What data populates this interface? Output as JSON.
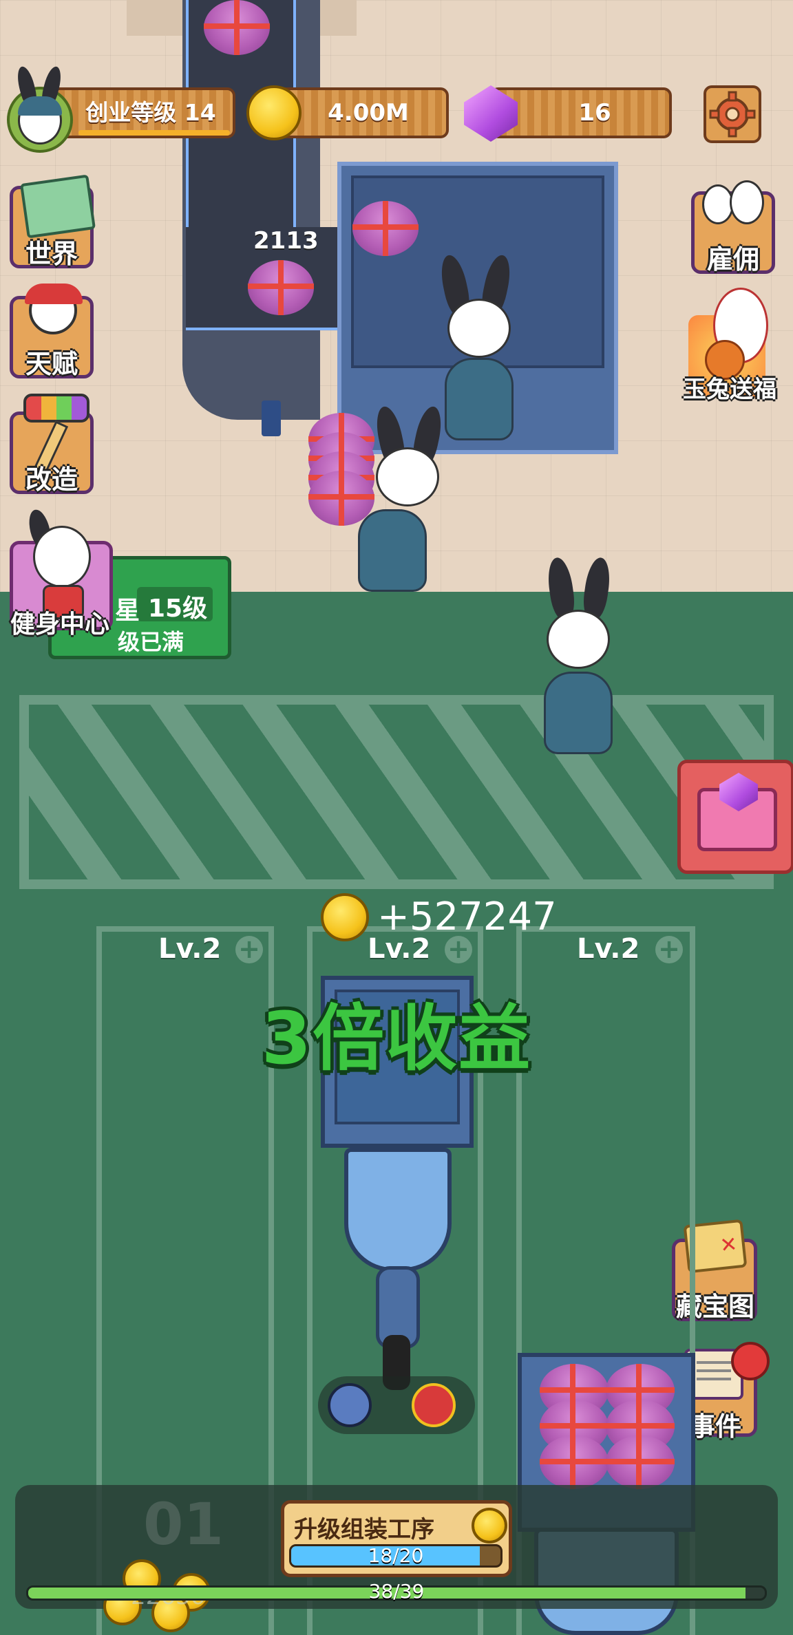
{
  "hud": {
    "level_label": "创业等级 14",
    "coins": "4.00M",
    "gems": "16",
    "settings_icon": "gear-icon"
  },
  "left_menu": [
    {
      "label": "世界",
      "icon": "world-map-icon"
    },
    {
      "label": "天赋",
      "icon": "talent-icon"
    },
    {
      "label": "改造",
      "icon": "paint-roller-icon"
    },
    {
      "label": "健身中心",
      "icon": "gym-icon"
    }
  ],
  "right_menu": [
    {
      "label": "雇佣",
      "icon": "hire-rabbits-icon"
    },
    {
      "label": "玉兔送福",
      "icon": "jade-rabbit-icon"
    },
    {
      "label": "藏宝图",
      "icon": "treasure-map-icon"
    },
    {
      "label": "事件",
      "icon": "events-icon"
    }
  ],
  "gym_sign": {
    "level": "15级",
    "status_fragment": "级已满",
    "cut_fragment": "星"
  },
  "conveyor_counter": "2113",
  "income_popup": "+527247",
  "multiplier_banner": "3倍收益",
  "lanes": [
    {
      "label": "Lv.2"
    },
    {
      "label": "Lv.2"
    },
    {
      "label": "Lv.2"
    }
  ],
  "bottom": {
    "station_number": "01",
    "upgrade_title": "升级组装工序",
    "upgrade_progress_text": "18/20",
    "upgrade_progress": 0.9,
    "main_progress_text": "38/39",
    "main_progress": 0.974,
    "hidden_count_fragment": "22636"
  },
  "colors": {
    "floor": "#e7d5c2",
    "grass": "#3d7a5c",
    "banner_green": "#3cc641",
    "accent_orange": "#c8843a"
  }
}
